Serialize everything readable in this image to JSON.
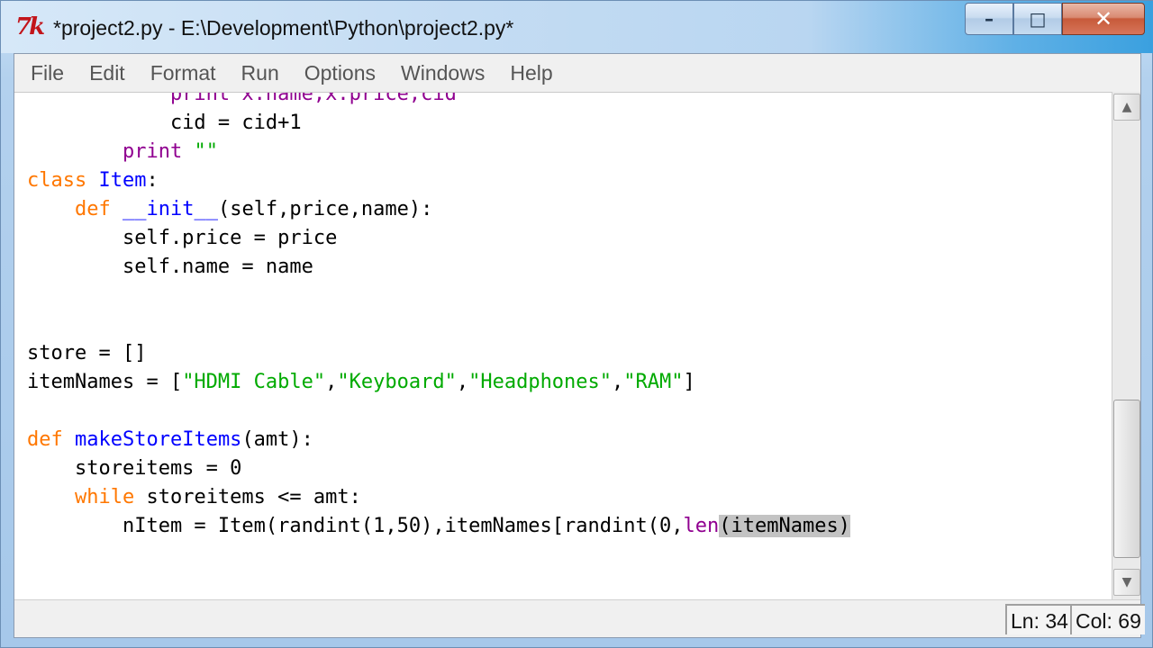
{
  "window": {
    "title": "*project2.py - E:\\Development\\Python\\project2.py*",
    "app_icon_text": "7k",
    "buttons": {
      "minimize": "–",
      "maximize": "□",
      "close": "✕"
    }
  },
  "menu": [
    {
      "label": "File"
    },
    {
      "label": "Edit"
    },
    {
      "label": "Format"
    },
    {
      "label": "Run"
    },
    {
      "label": "Options"
    },
    {
      "label": "Windows"
    },
    {
      "label": "Help"
    }
  ],
  "code": {
    "partial_top_line": "            print x.name,x.price,cid",
    "lines": [
      "            cid = cid+1",
      "        print \"\"",
      "class Item:",
      "    def __init__(self,price,name):",
      "        self.price = price",
      "        self.name = name",
      "",
      "",
      "store = []",
      "itemNames = [\"HDMI Cable\",\"Keyboard\",\"Headphones\",\"RAM\"]",
      "",
      "def makeStoreItems(amt):",
      "    storeitems = 0",
      "    while storeitems <= amt:",
      "        nItem = Item(randint(1,50),itemNames[randint(0,len(itemNames)"
    ]
  },
  "status": {
    "line": "Ln: 34",
    "col": "Col: 69"
  },
  "scrollbar": {
    "up_arrow_icon": "scroll-up-arrow",
    "down_arrow_icon": "scroll-down-arrow"
  },
  "colors": {
    "keyword": "#ff7700",
    "definition": "#0000ff",
    "string": "#00aa00",
    "builtin": "#900090",
    "highlight": "#c3c3c3"
  }
}
